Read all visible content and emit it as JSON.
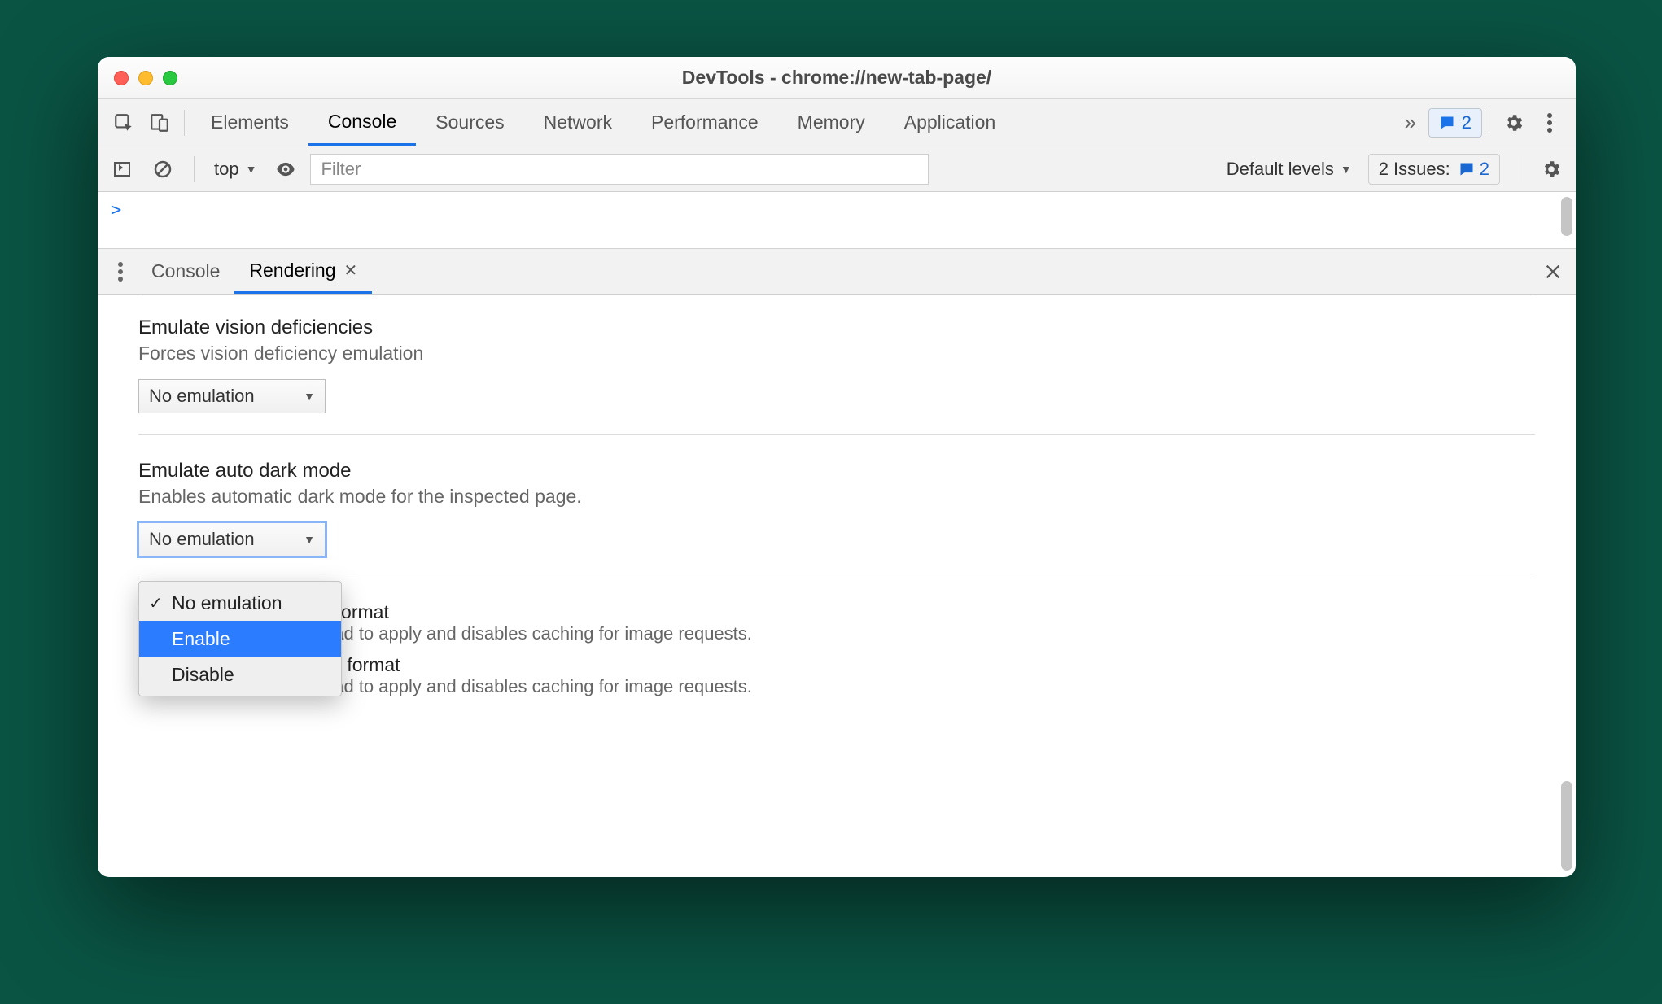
{
  "window": {
    "title": "DevTools - chrome://new-tab-page/"
  },
  "tabs": {
    "items": [
      "Elements",
      "Console",
      "Sources",
      "Network",
      "Performance",
      "Memory",
      "Application"
    ],
    "active_index": 1,
    "message_count": "2"
  },
  "console_toolbar": {
    "context": "top",
    "filter_placeholder": "Filter",
    "levels_label": "Default levels",
    "issues_label": "2 Issues:",
    "issues_count": "2"
  },
  "console_body": {
    "prompt": ">"
  },
  "drawer": {
    "tabs": [
      {
        "label": "Console",
        "active": false,
        "closeable": false
      },
      {
        "label": "Rendering",
        "active": true,
        "closeable": true
      }
    ]
  },
  "rendering": {
    "vision": {
      "title": "Emulate vision deficiencies",
      "desc": "Forces vision deficiency emulation",
      "selected": "No emulation"
    },
    "darkmode": {
      "title": "Emulate auto dark mode",
      "desc": "Enables automatic dark mode for the inspected page.",
      "selected": "No emulation",
      "options": [
        "No emulation",
        "Enable",
        "Disable"
      ],
      "highlight_index": 1
    },
    "avif": {
      "title": "Disable AVIF image format",
      "desc": "Requires a page reload to apply and disables caching for image requests."
    },
    "webp": {
      "title": "Disable WebP image format",
      "desc": "Requires a page reload to apply and disables caching for image requests."
    }
  }
}
